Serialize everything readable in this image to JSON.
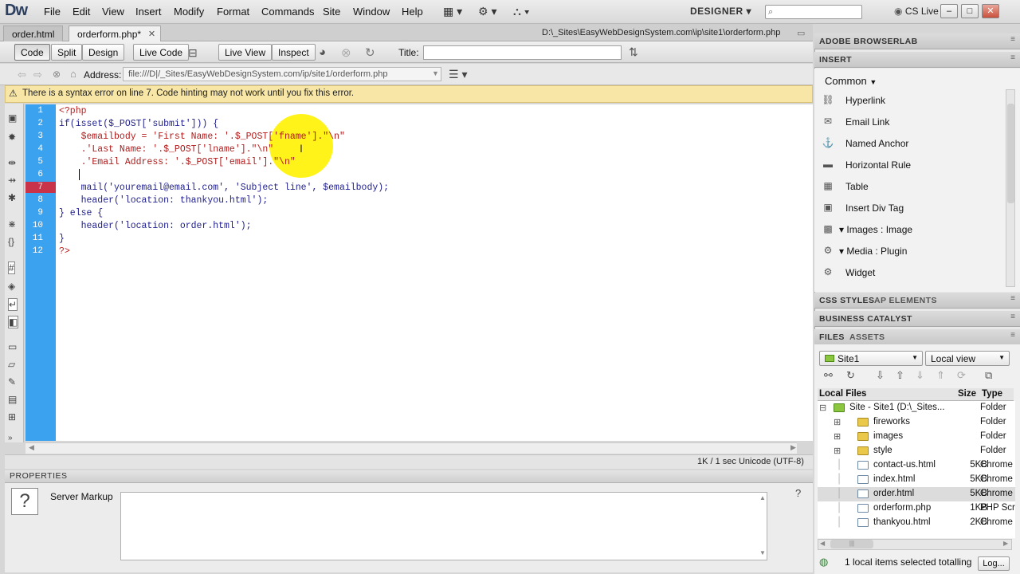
{
  "app": {
    "logo": "Dw",
    "menus": [
      "File",
      "Edit",
      "View",
      "Insert",
      "Modify",
      "Format",
      "Commands",
      "Site",
      "Window",
      "Help"
    ],
    "workspace": "DESIGNER",
    "cs_live": "CS Live"
  },
  "tabs": [
    {
      "label": "order.html",
      "active": false
    },
    {
      "label": "orderform.php*",
      "active": true
    }
  ],
  "file_path": "D:\\_Sites\\EasyWebDesignSystem.com\\ip\\site1\\orderform.php",
  "doc_toolbar": {
    "code": "Code",
    "split": "Split",
    "design": "Design",
    "live_code": "Live Code",
    "live_view": "Live View",
    "inspect": "Inspect",
    "title_label": "Title:",
    "title_value": ""
  },
  "address": {
    "label": "Address:",
    "value": "file:///D|/_Sites/EasyWebDesignSystem.com/ip/site1/orderform.php"
  },
  "warning": "There is a syntax error on line 7.  Code hinting may not work until you fix this error.",
  "code": {
    "line_numbers": [
      "1",
      "2",
      "3",
      "4",
      "5",
      "6",
      "7",
      "8",
      "9",
      "10",
      "11",
      "12"
    ],
    "error_line": 7,
    "lines": [
      "<?php",
      "if(isset($_POST['submit'])) {",
      "    $emailbody = 'First Name: '.$_POST['fname'].\"\\n\"",
      "    .'Last Name: '.$_POST['lname'].\"\\n\"",
      "    .'Email Address: '.$_POST['email'].\"\\n\"",
      "    ",
      "    mail('youremail@email.com', 'Subject line', $emailbody);",
      "    header('location: thankyou.html');",
      "} else {",
      "    header('location: order.html');",
      "}",
      "?>"
    ]
  },
  "status": "1K / 1 sec  Unicode (UTF-8)",
  "properties": {
    "title": "PROPERTIES",
    "label": "Server Markup",
    "help": "?"
  },
  "panels": {
    "browserlab": "ADOBE BROWSERLAB",
    "insert": "INSERT",
    "insert_category": "Common",
    "insert_items": [
      {
        "label": "Hyperlink",
        "icon": "hyperlink-icon"
      },
      {
        "label": "Email Link",
        "icon": "email-icon"
      },
      {
        "label": "Named Anchor",
        "icon": "anchor-icon"
      },
      {
        "label": "Horizontal Rule",
        "icon": "hr-icon"
      },
      {
        "label": "Table",
        "icon": "table-icon"
      },
      {
        "label": "Insert Div Tag",
        "icon": "div-icon"
      },
      {
        "label": "Images : Image",
        "icon": "image-icon"
      },
      {
        "label": "Media : Plugin",
        "icon": "plugin-icon"
      },
      {
        "label": "Widget",
        "icon": "widget-icon"
      }
    ],
    "css_styles": "CSS STYLES",
    "ap_elements": "AP ELEMENTS",
    "business_catalyst": "BUSINESS CATALYST",
    "files_tab": "FILES",
    "assets_tab": "ASSETS",
    "site_select": "Site1",
    "view_select": "Local view",
    "columns": {
      "name": "Local Files",
      "size": "Size",
      "type": "Type"
    },
    "files": [
      {
        "name": "Site - Site1 (D:\\_Sites...",
        "size": "",
        "type": "Folder",
        "kind": "site",
        "indent": 0,
        "expander": "⊟"
      },
      {
        "name": "fireworks",
        "size": "",
        "type": "Folder",
        "kind": "folder",
        "indent": 1,
        "expander": "⊞"
      },
      {
        "name": "images",
        "size": "",
        "type": "Folder",
        "kind": "folder",
        "indent": 1,
        "expander": "⊞"
      },
      {
        "name": "style",
        "size": "",
        "type": "Folder",
        "kind": "folder",
        "indent": 1,
        "expander": "⊞"
      },
      {
        "name": "contact-us.html",
        "size": "5KB",
        "type": "Chrome",
        "kind": "page",
        "indent": 1,
        "expander": ""
      },
      {
        "name": "index.html",
        "size": "5KB",
        "type": "Chrome",
        "kind": "page",
        "indent": 1,
        "expander": ""
      },
      {
        "name": "order.html",
        "size": "5KB",
        "type": "Chrome",
        "kind": "page",
        "indent": 1,
        "expander": ""
      },
      {
        "name": "orderform.php",
        "size": "1KB",
        "type": "PHP Script",
        "kind": "page",
        "indent": 1,
        "expander": ""
      },
      {
        "name": "thankyou.html",
        "size": "2KB",
        "type": "Chrome",
        "kind": "page",
        "indent": 1,
        "expander": ""
      }
    ],
    "selected_file": "order.html",
    "files_status": "1 local items selected totalling",
    "log_button": "Log..."
  }
}
